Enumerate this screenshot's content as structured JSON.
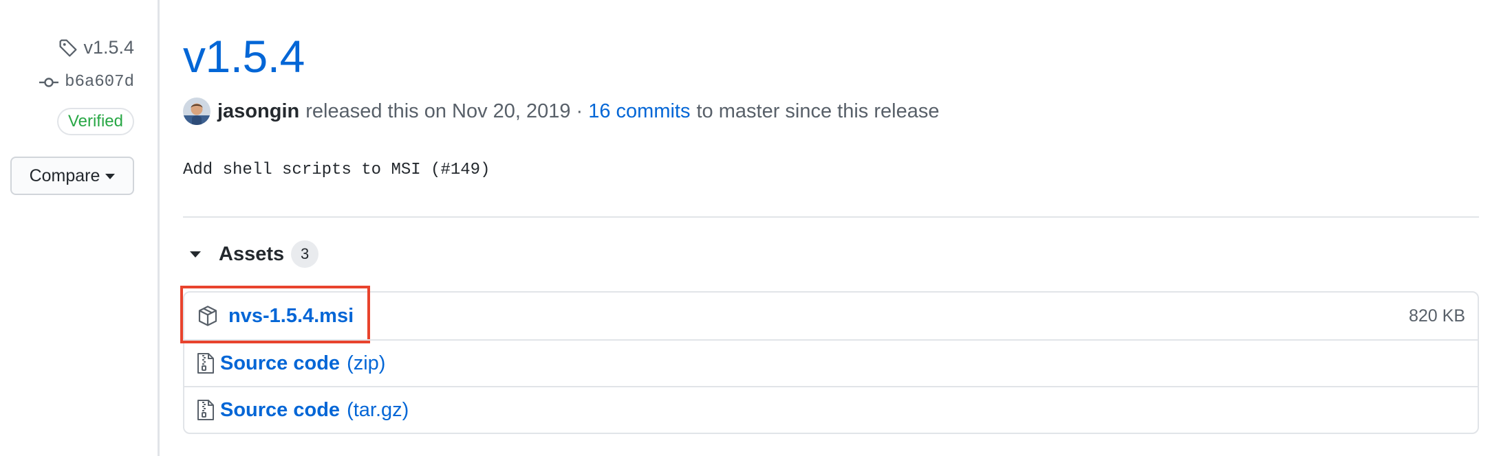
{
  "sidebar": {
    "tag_label": "v1.5.4",
    "commit_sha": "b6a607d",
    "verified_label": "Verified",
    "compare_label": "Compare"
  },
  "release": {
    "title": "v1.5.4",
    "author": "jasongin",
    "released_text": "released this on Nov 20, 2019",
    "separator": "·",
    "commits_link": "16 commits",
    "commits_suffix": "to master since this release",
    "body": "Add shell scripts to MSI (#149)"
  },
  "assets": {
    "title": "Assets",
    "count": "3",
    "items": [
      {
        "name": "nvs-1.5.4.msi",
        "suffix": "",
        "size": "820 KB",
        "icon": "package-icon"
      },
      {
        "name": "Source code",
        "suffix": "(zip)",
        "size": "",
        "icon": "file-zip-icon"
      },
      {
        "name": "Source code",
        "suffix": "(tar.gz)",
        "size": "",
        "icon": "file-zip-icon"
      }
    ]
  },
  "colors": {
    "link": "#0366d6",
    "verified": "#28a745",
    "highlight": "#e8432d"
  }
}
